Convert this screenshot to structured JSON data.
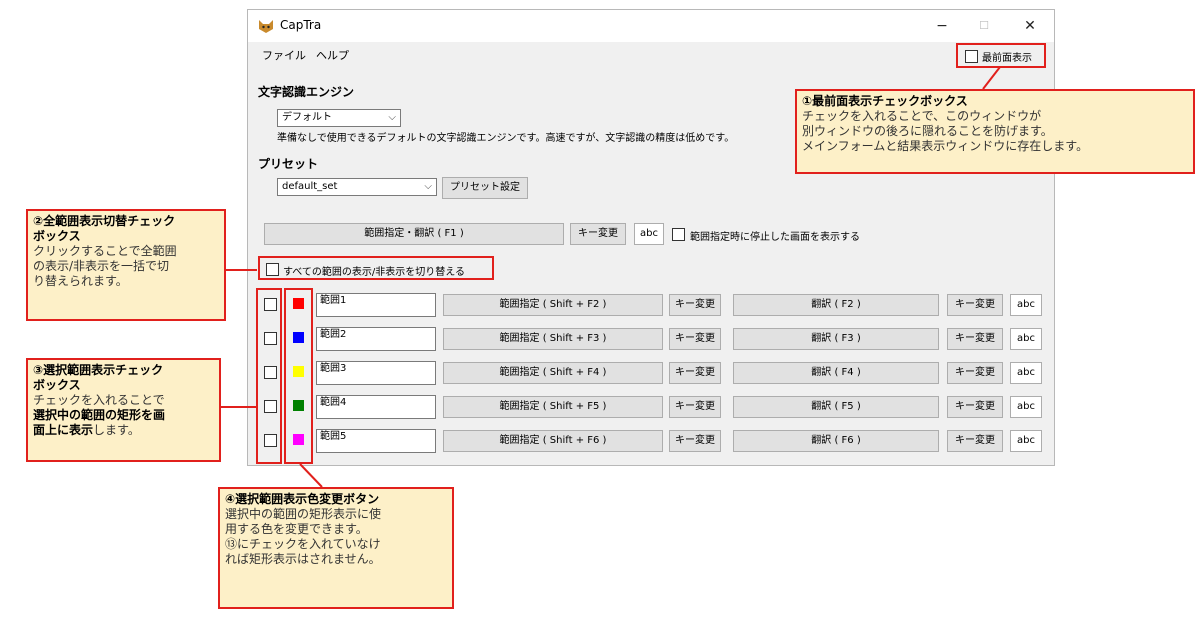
{
  "window": {
    "title": "CapTra",
    "controls": {
      "minimize": "−",
      "maximize": "☐",
      "close": "✕"
    }
  },
  "menu": {
    "file": "ファイル",
    "help": "ヘルプ"
  },
  "topmost": {
    "label": "最前面表示",
    "checked": false
  },
  "engine": {
    "heading": "文字認識エンジン",
    "selected": "デフォルト",
    "description": "準備なしで使用できるデフォルトの文字認識エンジンです。高速ですが、文字認識の精度は低めです。"
  },
  "preset": {
    "heading": "プリセット",
    "selected": "default_set",
    "settings_button": "プリセット設定"
  },
  "main_row": {
    "translate_button": "範囲指定・翻訳 ( F1 )",
    "key_change": "キー変更",
    "abc": "abc",
    "freeze_label": "範囲指定時に停止した画面を表示する"
  },
  "toggle_all": {
    "label": "すべての範囲の表示/非表示を切り替える"
  },
  "ranges": [
    {
      "name": "範囲1",
      "color": "#ff0000",
      "select_btn": "範囲指定 ( Shift + F2 )",
      "key1": "キー変更",
      "translate_btn": "翻訳 ( F2 )",
      "key2": "キー変更",
      "abc": "abc"
    },
    {
      "name": "範囲2",
      "color": "#0000ff",
      "select_btn": "範囲指定 ( Shift + F3 )",
      "key1": "キー変更",
      "translate_btn": "翻訳 ( F3 )",
      "key2": "キー変更",
      "abc": "abc"
    },
    {
      "name": "範囲3",
      "color": "#ffff00",
      "select_btn": "範囲指定 ( Shift + F4 )",
      "key1": "キー変更",
      "translate_btn": "翻訳 ( F4 )",
      "key2": "キー変更",
      "abc": "abc"
    },
    {
      "name": "範囲4",
      "color": "#008000",
      "select_btn": "範囲指定 ( Shift + F5 )",
      "key1": "キー変更",
      "translate_btn": "翻訳 ( F5 )",
      "key2": "キー変更",
      "abc": "abc"
    },
    {
      "name": "範囲5",
      "color": "#ff00ff",
      "select_btn": "範囲指定 ( Shift + F6 )",
      "key1": "キー変更",
      "translate_btn": "翻訳 ( F6 )",
      "key2": "キー変更",
      "abc": "abc"
    }
  ],
  "callouts": {
    "c1": {
      "title": "①最前面表示チェックボックス",
      "line1": "チェックを入れることで、このウィンドウが",
      "line2": "別ウィンドウの後ろに隠れることを防げます。",
      "line3": "メインフォームと結果表示ウィンドウに存在します。"
    },
    "c2": {
      "title1": "②全範囲表示切替チェック",
      "title2": "ボックス",
      "line1": "クリックすることで全範囲",
      "line2": "の表示/非表示を一括で切",
      "line3": "り替えられます。"
    },
    "c3": {
      "title1": "③選択範囲表示チェック",
      "title2": "ボックス",
      "line1": "チェックを入れることで",
      "bold1": "選択中の範囲の矩形を画",
      "bold2": "面上に表示",
      "tail": "します。"
    },
    "c4": {
      "title": "④選択範囲表示色変更ボタン",
      "line1": "選択中の範囲の矩形表示に使",
      "line2": "用する色を変更できます。",
      "line3": "⑬にチェックを入れていなけ",
      "line4": "れば矩形表示はされません。"
    }
  }
}
